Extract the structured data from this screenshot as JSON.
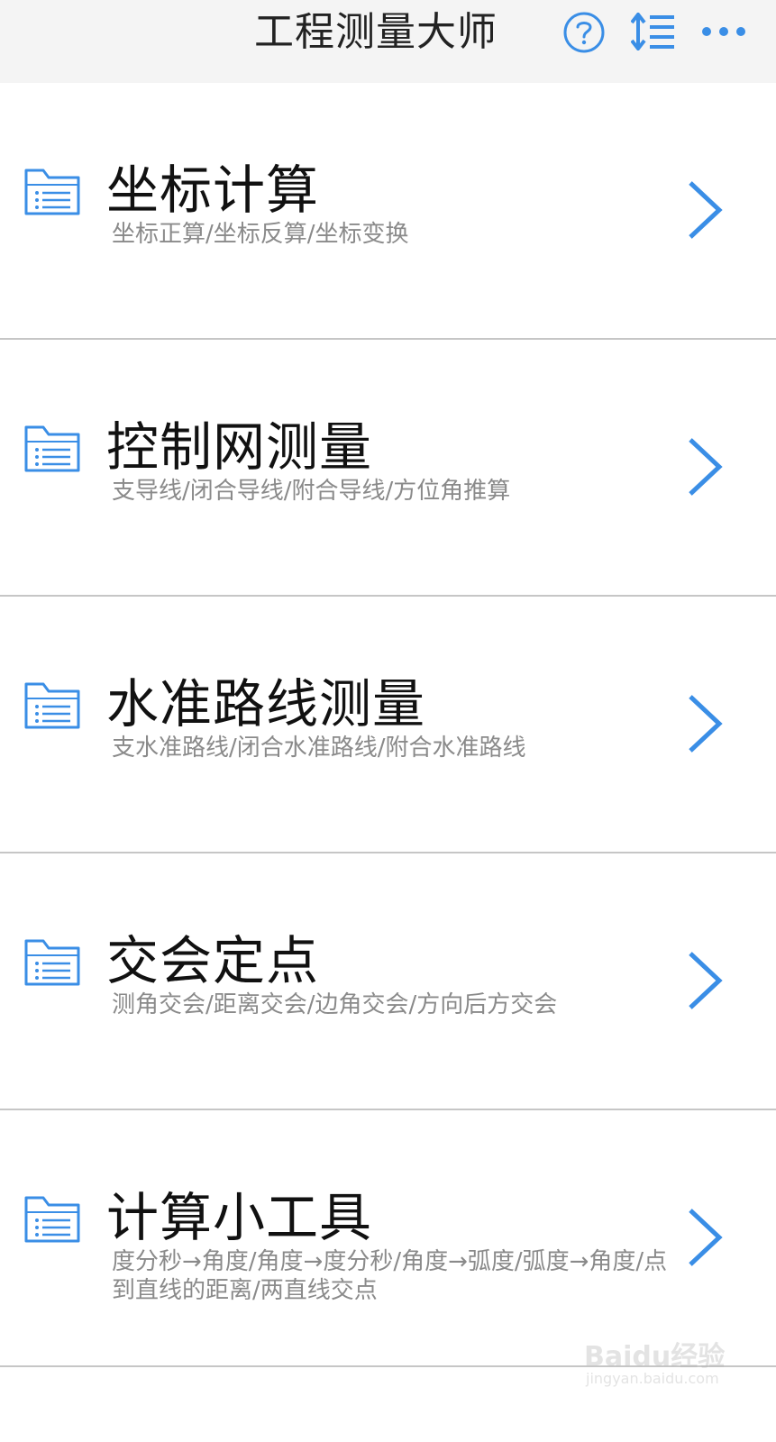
{
  "header": {
    "title": "工程测量大师",
    "icons": [
      "help-icon",
      "sort-icon",
      "more-icon"
    ]
  },
  "colors": {
    "accent": "#3a8ee6",
    "header_bg": "#f4f4f4",
    "divider": "#c6c6c6",
    "subtitle": "#8a8a8a"
  },
  "menu": [
    {
      "title": "坐标计算",
      "subtitle": "坐标正算/坐标反算/坐标变换",
      "icon": "folder-icon"
    },
    {
      "title": "控制网测量",
      "subtitle": "支导线/闭合导线/附合导线/方位角推算",
      "icon": "folder-icon"
    },
    {
      "title": "水准路线测量",
      "subtitle": "支水准路线/闭合水准路线/附合水准路线",
      "icon": "folder-icon"
    },
    {
      "title": "交会定点",
      "subtitle": "测角交会/距离交会/边角交会/方向后方交会",
      "icon": "folder-icon"
    },
    {
      "title": "计算小工具",
      "subtitle": "度分秒→角度/角度→度分秒/角度→弧度/弧度→角度/点到直线的距离/两直线交点",
      "icon": "folder-icon"
    }
  ],
  "watermark": {
    "main": "Baidu经验",
    "sub": "jingyan.baidu.com"
  }
}
